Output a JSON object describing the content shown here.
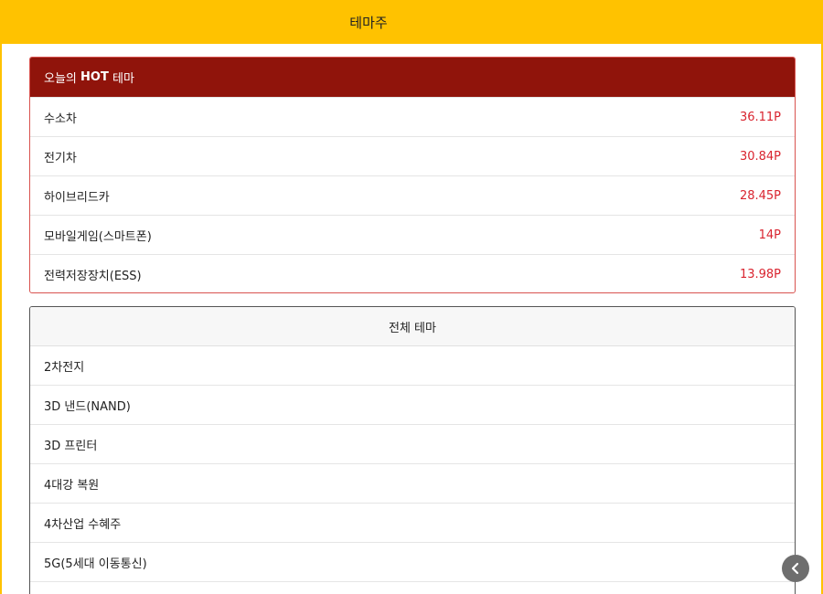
{
  "header": {
    "title": "테마주"
  },
  "hot": {
    "title_prefix": "오늘의 ",
    "title_bold": "HOT",
    "title_suffix": " 테마",
    "items": [
      {
        "name": "수소차",
        "value": "36.11P"
      },
      {
        "name": "전기차",
        "value": "30.84P"
      },
      {
        "name": "하이브리드카",
        "value": "28.45P"
      },
      {
        "name": "모바일게임(스마트폰)",
        "value": "14P"
      },
      {
        "name": "전력저장장치(ESS)",
        "value": "13.98P"
      }
    ]
  },
  "all": {
    "title": "전체 테마",
    "items": [
      {
        "name": "2차전지"
      },
      {
        "name": "3D 낸드(NAND)"
      },
      {
        "name": "3D 프린터"
      },
      {
        "name": "4대강 복원"
      },
      {
        "name": "4차산업 수혜주"
      },
      {
        "name": "5G(5세대 이동통신)"
      }
    ]
  },
  "colors": {
    "header_bg": "#ffc200",
    "hot_header_bg": "#90140b",
    "value_red": "#d9242f"
  },
  "icons": {
    "scroll_button": "chevron-left-icon"
  }
}
